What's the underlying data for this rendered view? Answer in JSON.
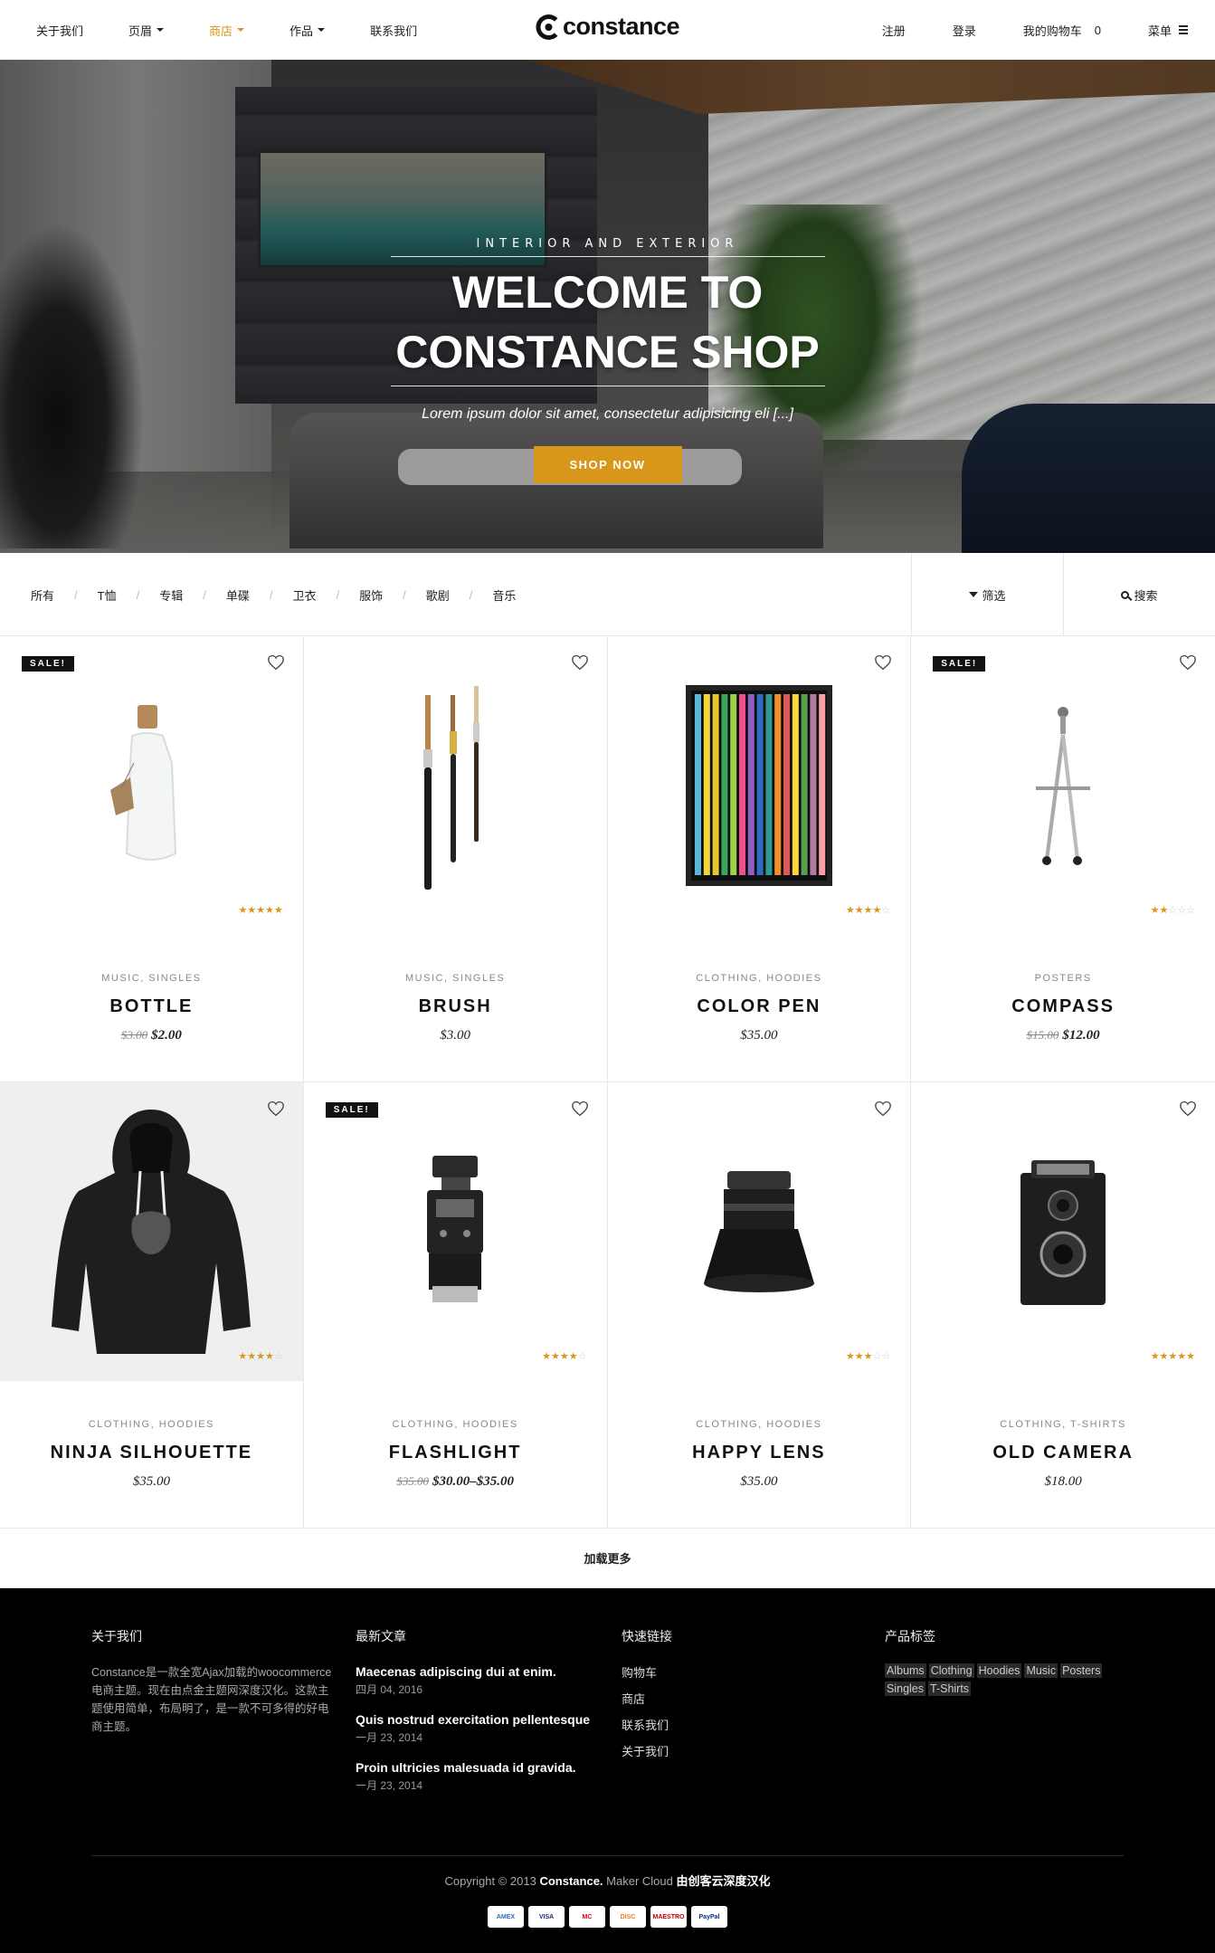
{
  "nav": {
    "left": [
      {
        "label": "关于我们",
        "caret": false,
        "active": false
      },
      {
        "label": "页眉",
        "caret": true,
        "active": false
      },
      {
        "label": "商店",
        "caret": true,
        "active": true
      },
      {
        "label": "作品",
        "caret": true,
        "active": false
      },
      {
        "label": "联系我们",
        "caret": false,
        "active": false
      }
    ],
    "logo": "constance",
    "right": {
      "register": "注册",
      "login": "登录",
      "cart_label": "我的购物车",
      "cart_count": "0",
      "menu": "菜单"
    }
  },
  "hero": {
    "kicker": "INTERIOR AND EXTERIOR",
    "title_line1": "WELCOME TO",
    "title_line2": "CONSTANCE SHOP",
    "subtitle": "Lorem ipsum dolor sit amet, consectetur adipisicing eli [...]",
    "button": "SHOP NOW",
    "slides": 3,
    "active_slide": 0
  },
  "filters": {
    "categories": [
      "所有",
      "T恤",
      "专辑",
      "单碟",
      "卫衣",
      "服饰",
      "歌剧",
      "音乐"
    ],
    "filter_btn": "筛选",
    "search_btn": "搜索"
  },
  "products": [
    {
      "name": "BOTTLE",
      "cats": "MUSIC, SINGLES",
      "old": "$3.00",
      "price": "$2.00",
      "sale": true,
      "rating": 4.5,
      "icon": "bottle-image"
    },
    {
      "name": "BRUSH",
      "cats": "MUSIC, SINGLES",
      "old": "",
      "price": "$3.00",
      "sale": false,
      "rating": 0,
      "icon": "brush-image"
    },
    {
      "name": "COLOR PEN",
      "cats": "CLOTHING, HOODIES",
      "old": "",
      "price": "$35.00",
      "sale": false,
      "rating": 4,
      "icon": "color-pens-image"
    },
    {
      "name": "COMPASS",
      "cats": "POSTERS",
      "old": "$15.00",
      "price": "$12.00",
      "sale": true,
      "rating": 2,
      "icon": "compass-image"
    },
    {
      "name": "NINJA SILHOUETTE",
      "cats": "CLOTHING, HOODIES",
      "old": "",
      "price": "$35.00",
      "sale": false,
      "rating": 4,
      "icon": "hoodie-image"
    },
    {
      "name": "FLASHLIGHT",
      "cats": "CLOTHING, HOODIES",
      "old": "$35.00",
      "price": "$30.00–$35.00",
      "sale": true,
      "rating": 4,
      "icon": "flash-image"
    },
    {
      "name": "HAPPY LENS",
      "cats": "CLOTHING, HOODIES",
      "old": "",
      "price": "$35.00",
      "sale": false,
      "rating": 3,
      "icon": "lens-image"
    },
    {
      "name": "OLD CAMERA",
      "cats": "CLOTHING, T-SHIRTS",
      "old": "",
      "price": "$18.00",
      "sale": false,
      "rating": 5,
      "icon": "camera-image"
    }
  ],
  "sale_label": "SALE!",
  "load_more": "加载更多",
  "footer": {
    "about_title": "关于我们",
    "about_text": "Constance是一款全宽Ajax加载的woocommerce电商主题。现在由点金主题网深度汉化。这款主题使用简单，布局明了，是一款不可多得的好电商主题。",
    "posts_title": "最新文章",
    "posts": [
      {
        "title": "Maecenas adipiscing dui at enim.",
        "date": "四月 04, 2016"
      },
      {
        "title": "Quis nostrud exercitation pellentesque",
        "date": "一月 23, 2014"
      },
      {
        "title": "Proin ultricies malesuada id gravida.",
        "date": "一月 23, 2014"
      }
    ],
    "links_title": "快速链接",
    "links": [
      "购物车",
      "商店",
      "联系我们",
      "关于我们"
    ],
    "tags_title": "产品标签",
    "tags": [
      "Albums",
      "Clothing",
      "Hoodies",
      "Music",
      "Posters",
      "Singles",
      "T-Shirts"
    ],
    "copyright_pre": "Copyright © 2013",
    "copyright_brand": "Constance.",
    "copyright_mid": "Maker Cloud",
    "copyright_cn": "由创客云深度汉化",
    "payments": [
      "AMEX",
      "VISA",
      "MC",
      "DISC",
      "MAESTRO",
      "PayPal"
    ]
  },
  "colors": {
    "accent": "#d8971b",
    "dark": "#111111",
    "footer_bg": "#000000"
  }
}
